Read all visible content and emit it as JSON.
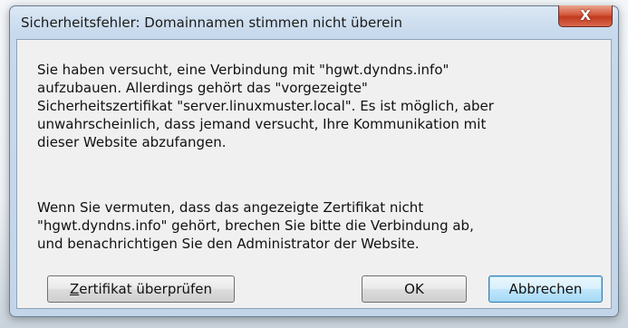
{
  "dialog": {
    "title": "Sicherheitsfehler: Domainnamen stimmen nicht überein",
    "close_glyph": "X",
    "message_1": "Sie haben versucht, eine Verbindung mit \"hgwt.dyndns.info\"\naufzubauen. Allerdings gehört das \"vorgezeigte\"\nSicherheitszertifikat \"server.linuxmuster.local\". Es ist möglich, aber\nunwahrscheinlich, dass jemand versucht, Ihre Kommunikation mit\ndieser Website abzufangen.",
    "message_2": "Wenn Sie vermuten, dass das angezeigte Zertifikat nicht\n\"hgwt.dyndns.info\" gehört, brechen Sie bitte die Verbindung ab,\nund benachrichtigen Sie den Administrator der Website."
  },
  "buttons": {
    "check_certificate_accel": "Z",
    "check_certificate_rest": "ertifikat überprüfen",
    "ok": "OK",
    "cancel": "Abbrechen"
  }
}
